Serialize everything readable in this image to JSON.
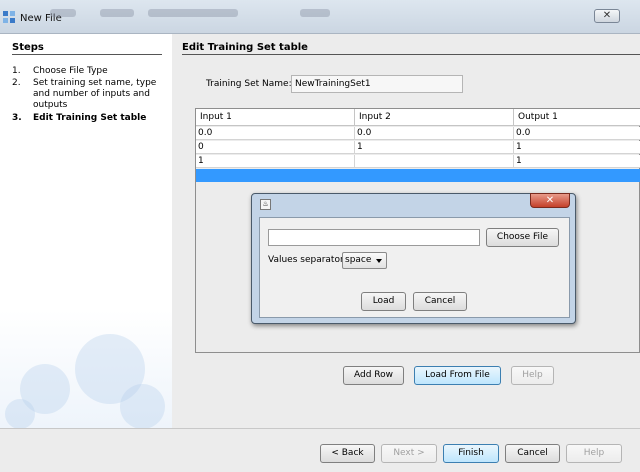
{
  "window": {
    "title": "New File",
    "close_glyph": "✕",
    "icon": "netbeans-cube-icon"
  },
  "steps": {
    "heading": "Steps",
    "items": [
      {
        "num": "1.",
        "label": "Choose File Type"
      },
      {
        "num": "2.",
        "label": "Set training set name, type and number of inputs and outputs"
      },
      {
        "num": "3.",
        "label": "Edit Training Set table",
        "current": true
      }
    ]
  },
  "content": {
    "heading": "Edit Training Set table",
    "name_label": "Training Set Name:",
    "name_value": "NewTrainingSet1"
  },
  "table": {
    "columns": [
      "Input 1",
      "Input 2",
      "Output 1"
    ],
    "rows": [
      [
        "0.0",
        "0.0",
        "0.0"
      ],
      [
        "0",
        "1",
        "1"
      ],
      [
        "1",
        "",
        "1"
      ],
      [
        "",
        "",
        ""
      ]
    ],
    "selected_row": 3,
    "selection_color": "#3399ff"
  },
  "table_buttons": {
    "add_row": "Add Row",
    "load_from_file": "Load From File",
    "help": "Help"
  },
  "nav": {
    "back": "< Back",
    "next": "Next >",
    "finish": "Finish",
    "cancel": "Cancel",
    "help": "Help"
  },
  "dialog": {
    "icon": "java-cup-icon",
    "close_glyph": "✕",
    "file_path": "",
    "choose_file": "Choose File",
    "separator_label": "Values separator",
    "separator_value": "space",
    "load": "Load",
    "cancel": "Cancel"
  }
}
